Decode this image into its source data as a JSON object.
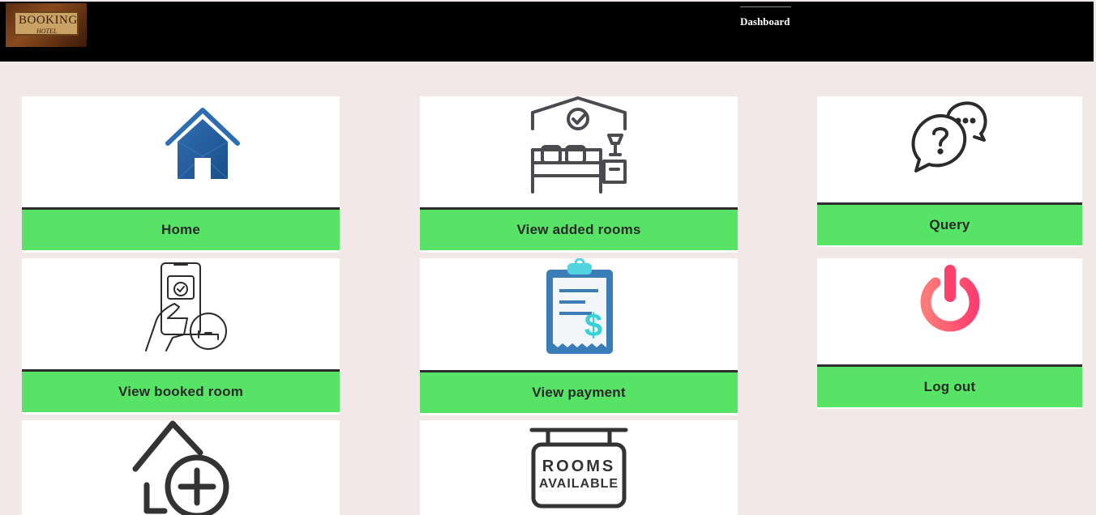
{
  "header": {
    "logo_text": "BOOKING",
    "logo_sub": "HOTEL",
    "nav_dashboard": "Dashboard"
  },
  "cards": {
    "home": {
      "label": "Home",
      "icon": "house-icon"
    },
    "view_added_rooms": {
      "label": "View added rooms",
      "icon": "bedroom-icon"
    },
    "query": {
      "label": "Query",
      "icon": "question-chat-icon"
    },
    "view_booked_room": {
      "label": "View booked room",
      "icon": "phone-booking-icon"
    },
    "view_payment": {
      "label": "View payment",
      "icon": "payment-receipt-icon"
    },
    "log_out": {
      "label": "Log out",
      "icon": "power-icon"
    },
    "add_room": {
      "icon": "add-house-icon"
    },
    "rooms_available": {
      "icon": "rooms-available-sign-icon",
      "sign_line1": "ROOMS",
      "sign_line2": "AVAILABLE"
    }
  },
  "colors": {
    "label_bg": "#57e365",
    "page_bg": "#f1e8e7",
    "header_bg": "#000000"
  }
}
